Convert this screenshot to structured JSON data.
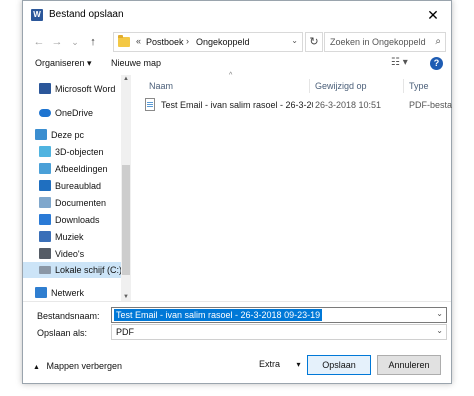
{
  "window": {
    "title": "Bestand opslaan",
    "app_icon_letter": "W",
    "close_glyph": "✕"
  },
  "nav": {
    "back_glyph": "←",
    "forward_glyph": "→",
    "recent_glyph": "⌄",
    "up_glyph": "↑"
  },
  "address": {
    "overflow": "«",
    "crumbs": [
      "Postboek",
      "Ongekoppeld"
    ],
    "separator": "›",
    "dropdown_glyph": "⌄",
    "refresh_glyph": "↻"
  },
  "search": {
    "placeholder": "Zoeken in Ongekoppeld",
    "icon_glyph": "⌕"
  },
  "toolbar": {
    "organize_label": "Organiseren ▾",
    "new_folder_label": "Nieuwe map",
    "view_glyph": "☷ ▾",
    "help_glyph": "?"
  },
  "sidebar": {
    "items": [
      {
        "label": "Microsoft Word",
        "icon": "word-icon",
        "color": "#2b579a"
      },
      {
        "label": "OneDrive",
        "icon": "onedrive-icon",
        "color": "#1e74d0"
      },
      {
        "label": "Deze pc",
        "icon": "computer-icon",
        "color": "#3b8ed0"
      },
      {
        "label": "3D-objecten",
        "icon": "cube-icon",
        "color": "#50b4e0"
      },
      {
        "label": "Afbeeldingen",
        "icon": "pictures-icon",
        "color": "#4aa0d8"
      },
      {
        "label": "Bureaublad",
        "icon": "desktop-icon",
        "color": "#1f6fc0"
      },
      {
        "label": "Documenten",
        "icon": "documents-icon",
        "color": "#7fa7cc"
      },
      {
        "label": "Downloads",
        "icon": "download-icon",
        "color": "#2a7ad6"
      },
      {
        "label": "Muziek",
        "icon": "music-icon",
        "color": "#3a6fb8"
      },
      {
        "label": "Video's",
        "icon": "video-icon",
        "color": "#555c66"
      },
      {
        "label": "Lokale schijf (C:)",
        "icon": "drive-icon",
        "color": "#8a97a6"
      },
      {
        "label": "Netwerk",
        "icon": "network-icon",
        "color": "#2f7ed0"
      }
    ],
    "scroll_up": "▲",
    "scroll_down": "▼"
  },
  "files": {
    "columns": [
      "Naam",
      "Gewijzigd op",
      "Type"
    ],
    "sort_glyph": "^",
    "rows": [
      {
        "name": "Test Email - ivan salim rasoel - 26-3-2018 ...",
        "modified": "26-3-2018 10:51",
        "type": "PDF-besta"
      }
    ]
  },
  "form": {
    "filename_label": "Bestandsnaam:",
    "filename_value": "Test Email - ivan salim rasoel - 26-3-2018 09-23-19",
    "savetype_label": "Opslaan als:",
    "savetype_value": "PDF",
    "dropdown_glyph": "⌄"
  },
  "footer": {
    "hide_folders_label": "Mappen verbergen",
    "hide_glyph": "▲",
    "extra_label": "Extra",
    "extra_glyph": "▾",
    "save_label": "Opslaan",
    "cancel_label": "Annuleren"
  },
  "colors": {
    "accent": "#0078d7",
    "selection": "#cce4f7"
  }
}
